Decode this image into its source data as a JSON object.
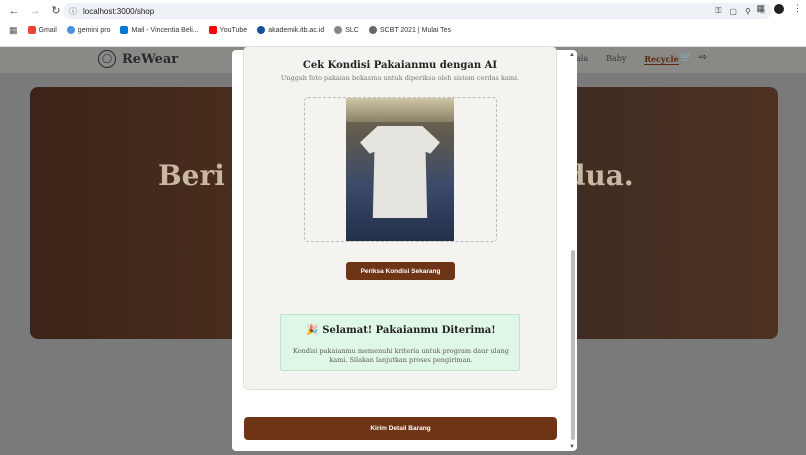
{
  "browser": {
    "url": "localhost:3000/shop",
    "bookmarks": [
      {
        "label": "Gmail",
        "icon": "gmail-icon",
        "color": "#ea4335"
      },
      {
        "label": "gemini pro",
        "icon": "gemini-icon",
        "color": "#4a90e2"
      },
      {
        "label": "Mail - Vincentia Beli...",
        "icon": "mail-icon",
        "color": "#0078d4"
      },
      {
        "label": "YouTube",
        "icon": "youtube-icon",
        "color": "#ff0000"
      },
      {
        "label": "akademik.itb.ac.id",
        "icon": "globe-icon",
        "color": "#1a4f9c"
      },
      {
        "label": "SLC",
        "icon": "slc-icon",
        "color": "#888888"
      },
      {
        "label": "SCBT 2021 | Mulai Tes",
        "icon": "scbt-icon",
        "color": "#666666"
      }
    ]
  },
  "site": {
    "brand": "ReWear",
    "nav": [
      {
        "label": "Baby",
        "active": false
      },
      {
        "label": "Recycle",
        "active": true
      }
    ],
    "nav_partial": "ala",
    "hero_left": "Beri K",
    "hero_right": "edua."
  },
  "modal": {
    "title": "Cek Kondisi Pakaianmu dengan AI",
    "subtitle": "Unggah foto pakaian bekasmu untuk diperiksa oleh sistem cerdas kami.",
    "check_button": "Periksa Kondisi Sekarang",
    "success_emoji": "🎉",
    "success_title": "Selamat! Pakaianmu Diterima!",
    "success_text": "Kondisi pakaianmu memenuhi kriteria untuk program daur ulang kami. Silakan lanjutkan proses pengiriman.",
    "submit_button": "Kirim Detail Barang"
  },
  "colors": {
    "accent": "#6d3515",
    "success_bg": "#dff7e6"
  }
}
